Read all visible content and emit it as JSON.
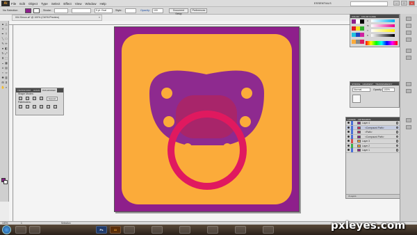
{
  "menubar": {
    "app_logo": "Ai",
    "items": [
      "File",
      "Edit",
      "Object",
      "Type",
      "Select",
      "Effect",
      "View",
      "Window",
      "Help"
    ],
    "workspace": "ESSENTIALS",
    "window_buttons": [
      "–",
      "□",
      "×"
    ]
  },
  "controlbar": {
    "selection_label": "No Selection",
    "stroke_label": "Stroke:",
    "stroke_weight": "",
    "brush": "5 pt. Oval",
    "style_label": "Style:",
    "opacity_label": "Opacity:",
    "opacity_value": "100",
    "document_setup": "Document Setup",
    "preferences": "Preferences",
    "fill_color": "#8e1f8b"
  },
  "document_tab": {
    "title": "004 Simon.ai* @ 100% (CMYK/Preview)",
    "close": "×"
  },
  "pathfinder": {
    "tabs": [
      "TRANSFORM",
      "ALIGN",
      "PATHFINDER"
    ],
    "shape_modes_label": "Shape Modes:",
    "pathfinders_label": "Pathfinders:",
    "expand_button": "Expand"
  },
  "color_panel": {
    "tabs": [
      "COLOR",
      "COLOR GUIDE"
    ],
    "channels": [
      "C",
      "M",
      "Y",
      "K"
    ]
  },
  "transparency_panel": {
    "tabs": [
      "STROKE",
      "GRADIENT",
      "TRANSPARENCY"
    ],
    "mode": "Normal",
    "opacity_label": "Opacity:",
    "opacity_value": "100%"
  },
  "layers_panel": {
    "tabs": [
      "LAYERS",
      "ARTBOARDS"
    ],
    "rows": [
      {
        "name": "Layer 4",
        "color": "#4a6fd8",
        "thumb": "#8e1f8b",
        "selected": false
      },
      {
        "name": "<Compound Path>",
        "color": "#4a6fd8",
        "thumb": "#e02060",
        "selected": true
      },
      {
        "name": "<Path>",
        "color": "#4a6fd8",
        "thumb": "#b02a70",
        "selected": false
      },
      {
        "name": "<Compound Path>",
        "color": "#4a6fd8",
        "thumb": "#8e1f8b",
        "selected": false
      },
      {
        "name": "Layer 3",
        "color": "#d84a4a",
        "thumb": "#f5a030",
        "selected": false
      },
      {
        "name": "Layer 2",
        "color": "#3db04a",
        "thumb": "#f5a030",
        "selected": false
      },
      {
        "name": "Layer 1",
        "color": "#4a6fd8",
        "thumb": "#8e1f8b",
        "selected": false
      }
    ],
    "footer": "4 Layers"
  },
  "statusbar": {
    "zoom": "100%",
    "page": "1",
    "tool": "Selection"
  },
  "taskbar": {
    "tasks": [
      "",
      "",
      "Ps",
      "Ai",
      "",
      "",
      "",
      "",
      "",
      ""
    ],
    "clock": "",
    "date": ""
  },
  "artwork": {
    "bg_color": "#8e1f8b",
    "tile_color": "#fbab3a",
    "shield_color": "#8e2a8f",
    "nipple_color": "#a8256a",
    "ring_color": "#e0195f",
    "dot_color": "#fbab3a"
  },
  "watermark": "pxleyes.com"
}
